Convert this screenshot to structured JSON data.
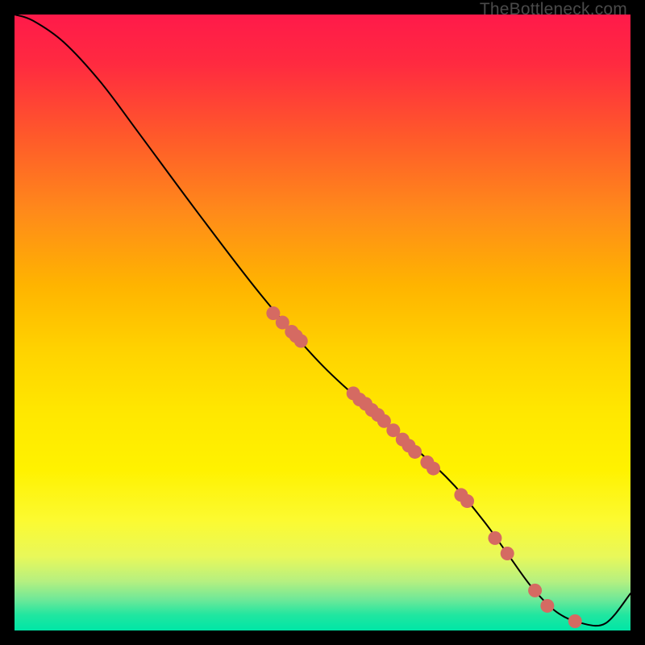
{
  "watermark": "TheBottleneck.com",
  "colors": {
    "marker": "#d56a62",
    "curve": "#000000",
    "frame": "#000000"
  },
  "chart_data": {
    "type": "line",
    "title": "",
    "xlabel": "",
    "ylabel": "",
    "xlim": [
      0,
      100
    ],
    "ylim": [
      0,
      100
    ],
    "x": [
      0,
      3,
      8,
      14,
      20,
      30,
      40,
      50,
      60,
      70,
      76,
      80,
      84,
      88,
      92,
      96,
      100
    ],
    "values": [
      100,
      99,
      95.5,
      89,
      81,
      67.5,
      54.5,
      43,
      34,
      25,
      18,
      12.5,
      7,
      3,
      1.2,
      1.2,
      6
    ],
    "markers_x": [
      42,
      43.5,
      45,
      45.7,
      46.5,
      55,
      56,
      57,
      58,
      59,
      60,
      61.5,
      63,
      64,
      65,
      67,
      68,
      72.5,
      73.5,
      78,
      80,
      84.5,
      86.5,
      91
    ],
    "markers_y": [
      51.5,
      50,
      48.5,
      47.8,
      47,
      38.5,
      37.5,
      36.8,
      35.8,
      35,
      34,
      32.5,
      31,
      30,
      29,
      27.3,
      26.3,
      22,
      21,
      15,
      12.5,
      6.5,
      4,
      1.5
    ]
  }
}
